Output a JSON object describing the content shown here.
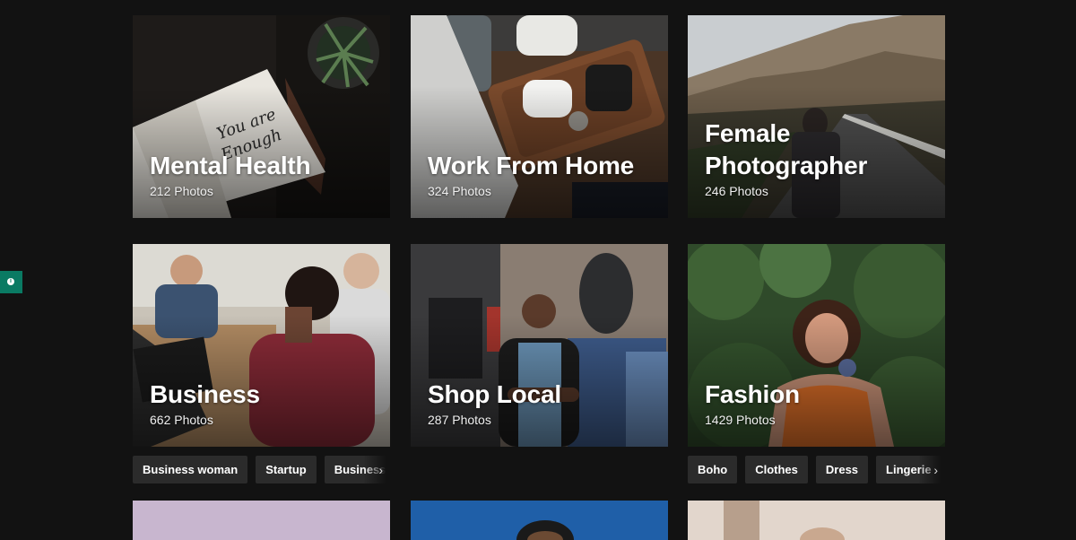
{
  "collections": [
    {
      "title": "Mental Health",
      "count": "212 Photos"
    },
    {
      "title": "Work From Home",
      "count": "324 Photos"
    },
    {
      "title": "Female Photographer",
      "count": "246 Photos"
    },
    {
      "title": "Business",
      "count": "662 Photos",
      "tags": [
        "Business woman",
        "Startup",
        "Business"
      ]
    },
    {
      "title": "Shop Local",
      "count": "287 Photos"
    },
    {
      "title": "Fashion",
      "count": "1429 Photos",
      "tags": [
        "Boho",
        "Clothes",
        "Dress",
        "Lingerie"
      ]
    }
  ],
  "feedback": {
    "icon": "info-icon"
  },
  "colors": {
    "background": "#121212",
    "tag_background": "#2b2b2b",
    "feedback": "#0a7a63"
  }
}
